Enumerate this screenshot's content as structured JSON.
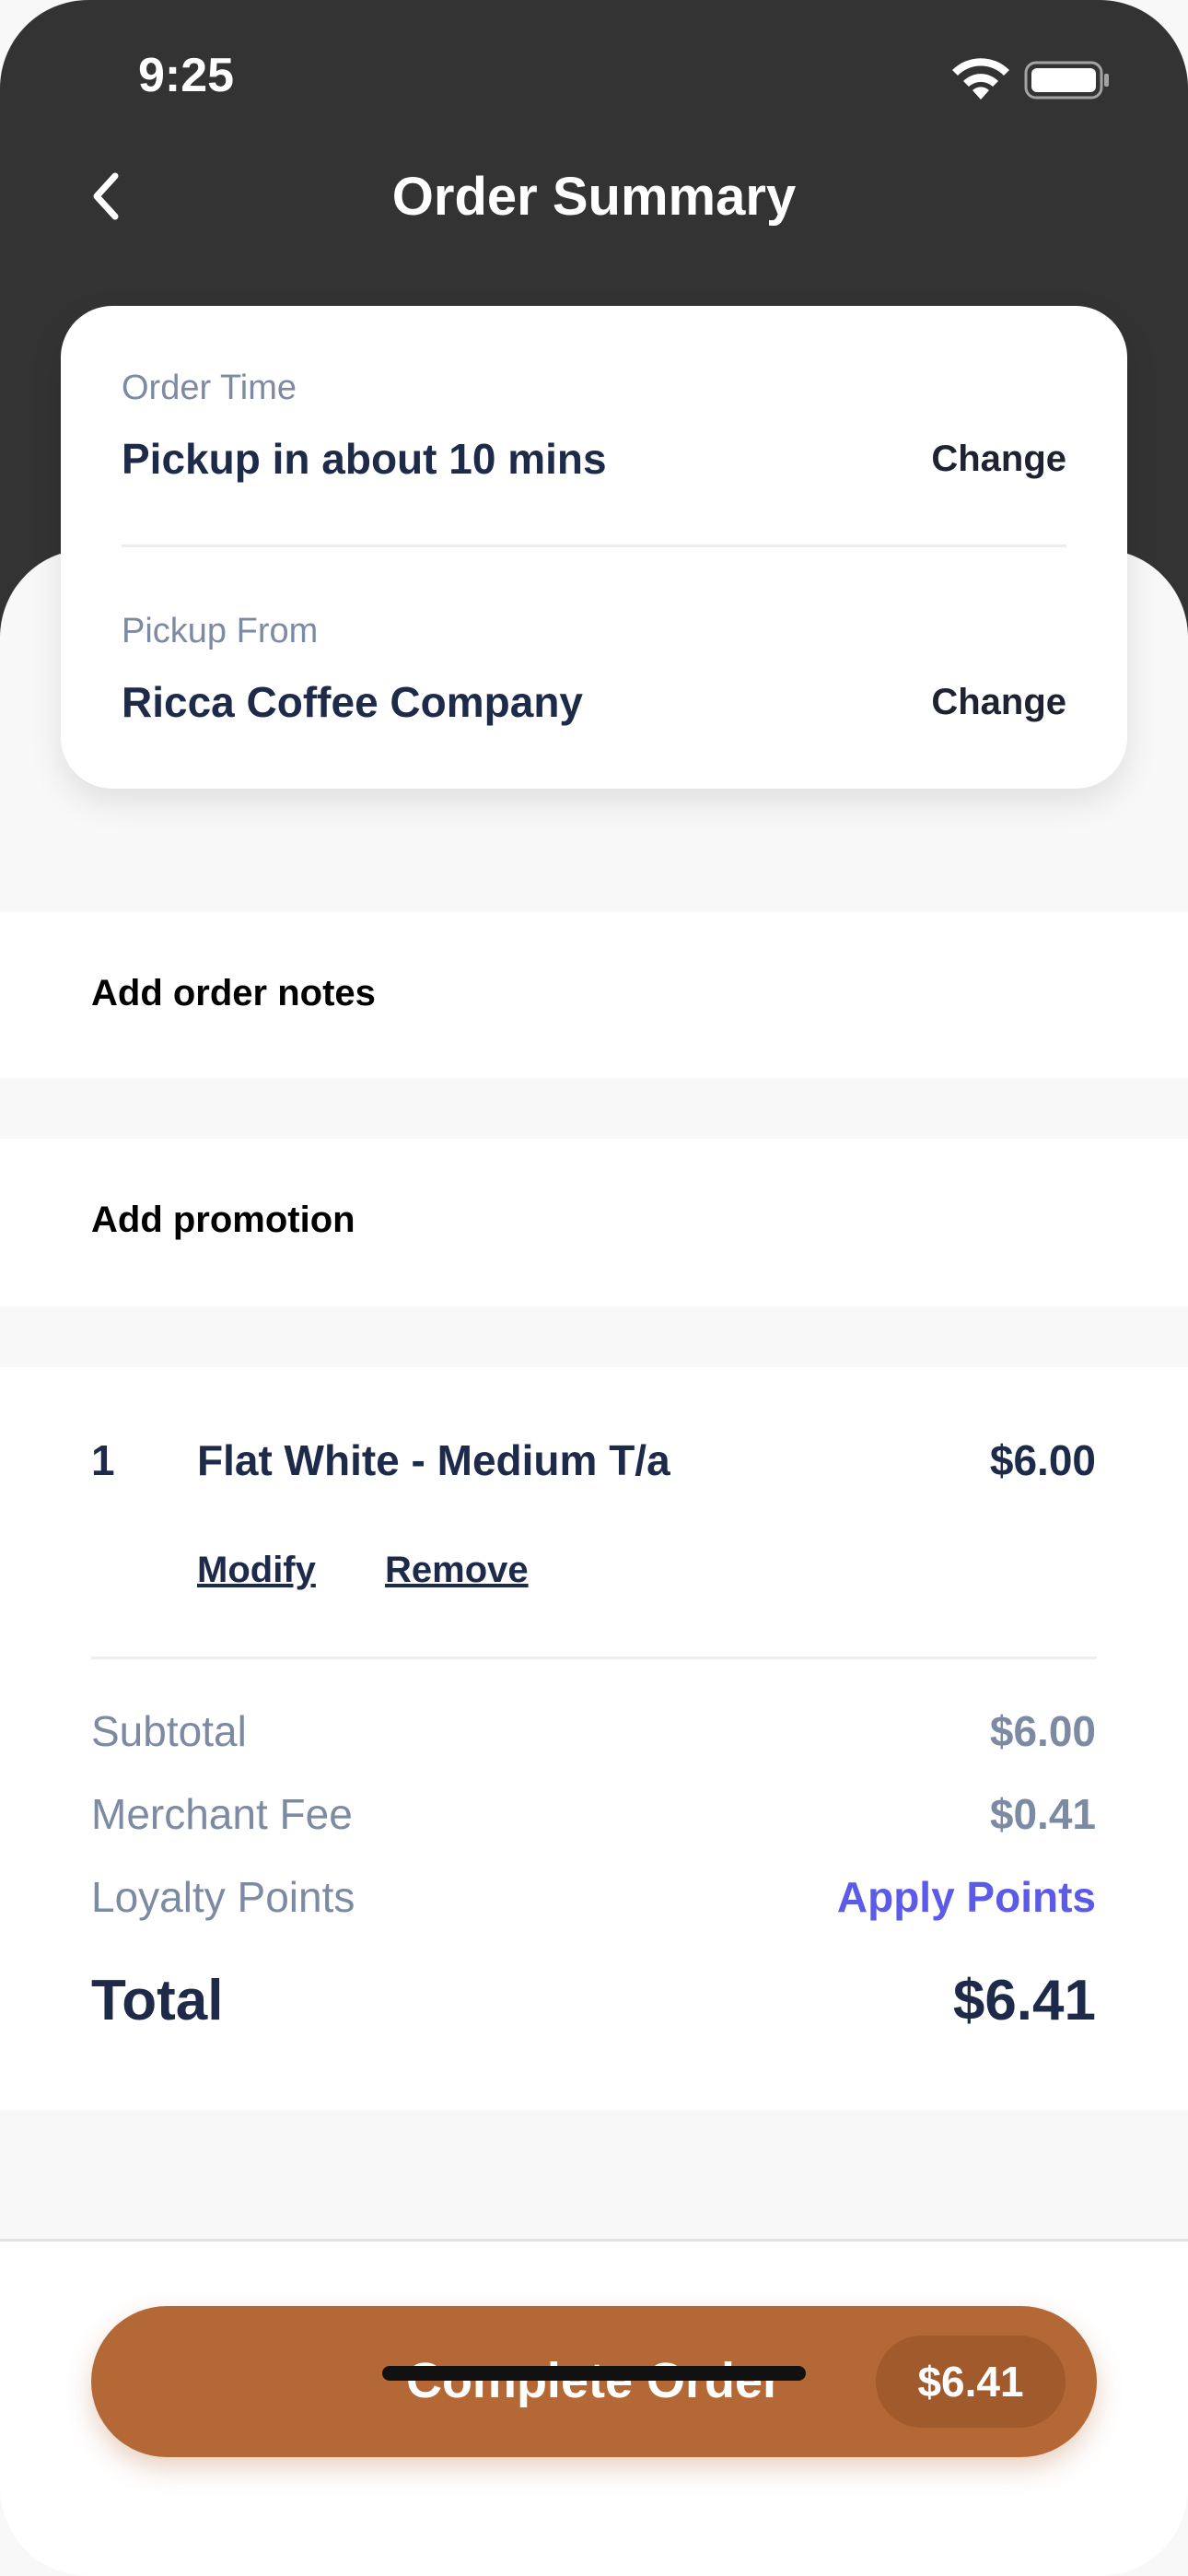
{
  "status_bar": {
    "time": "9:25"
  },
  "header": {
    "title": "Order Summary"
  },
  "order_card": {
    "order_time": {
      "label": "Order Time",
      "value": "Pickup in about 10 mins",
      "action": "Change"
    },
    "pickup_from": {
      "label": "Pickup From",
      "value": "Ricca Coffee Company",
      "action": "Change"
    }
  },
  "notes": {
    "label": "Add order notes"
  },
  "promotion": {
    "label": "Add promotion"
  },
  "order_item": {
    "quantity": "1",
    "name": "Flat White - Medium T/a",
    "price": "$6.00",
    "modify_label": "Modify",
    "remove_label": "Remove"
  },
  "summary": {
    "subtotal_label": "Subtotal",
    "subtotal_value": "$6.00",
    "fee_label": "Merchant Fee",
    "fee_value": "$0.41",
    "loyalty_label": "Loyalty Points",
    "loyalty_action": "Apply Points",
    "total_label": "Total",
    "total_value": "$6.41"
  },
  "cta": {
    "label": "Complete Order",
    "amount": "$6.41"
  },
  "colors": {
    "header_bg": "#333333",
    "accent": "#b46836",
    "link": "#5b5be8",
    "text_dark": "#1e2a4a",
    "text_muted": "#7d8aa3"
  },
  "icons": [
    "back-chevron-icon",
    "wifi-icon",
    "battery-icon"
  ]
}
